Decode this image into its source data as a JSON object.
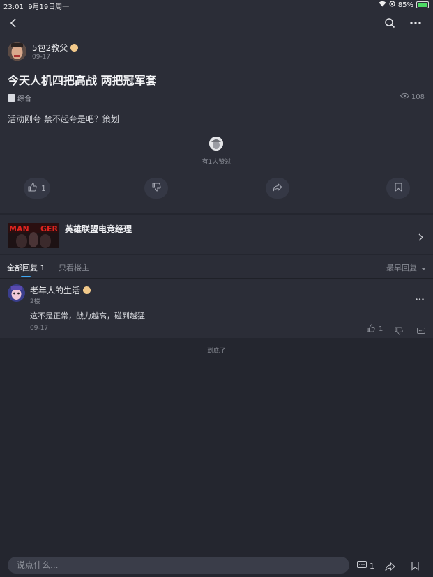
{
  "status_bar": {
    "time": "23:01",
    "date": "9月19日周一",
    "battery": "85%",
    "battery_level": 0.85
  },
  "nav": {
    "back_icon": "chevron-left-icon",
    "search_icon": "search-icon",
    "more_icon": "more-horizontal-icon"
  },
  "post": {
    "author": "5包2教父",
    "date": "09-17",
    "title": "今天人机四把高战 两把冠军套",
    "category": "综合",
    "views": "108",
    "body": "活动刚夸 禁不起夸是吧？策划",
    "likes_text": "有1人赞过",
    "like_count": "1"
  },
  "promo": {
    "title": "英雄联盟电竞经理"
  },
  "tabs": {
    "all_replies": "全部回复",
    "all_count": "1",
    "op_only": "只看楼主",
    "sort": "最早回复"
  },
  "replies": [
    {
      "author": "老年人的生活",
      "floor": "2楼",
      "content": "这不是正常，战力越高，碰到越猛",
      "date": "09-17",
      "like_count": "1"
    }
  ],
  "end_text": "到底了",
  "bottom": {
    "placeholder": "说点什么...",
    "comment_count": "1"
  },
  "colors": {
    "background": "#24262f",
    "card": "#2b2d37",
    "accent": "#3fa9f5",
    "badge": "#f2c98a"
  }
}
